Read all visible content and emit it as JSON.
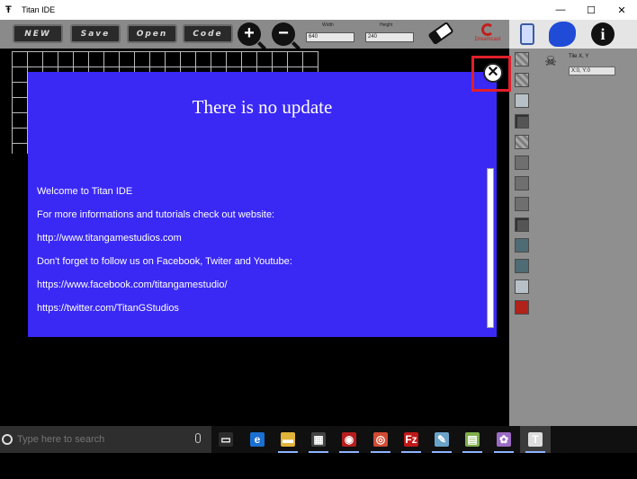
{
  "window": {
    "title": "Titan IDE",
    "controls": {
      "minimize": "—",
      "maximize": "☐",
      "close": "✕"
    }
  },
  "toolbar": {
    "new_label": "NEW",
    "save_label": "Save",
    "open_label": "Open",
    "code_label": "Code",
    "zoom_in": "+",
    "zoom_out": "−",
    "width_label": "Width",
    "width_value": "640",
    "height_label": "Height",
    "height_value": "240",
    "eraser_icon": "eraser-icon",
    "dreamcast_text": "Dreamcast"
  },
  "right_header": {
    "handheld_icon": "handheld-icon",
    "sonic_icon": "sonic-icon",
    "info_label": "i"
  },
  "right_panel": {
    "tile_label": "Tile X, Y",
    "tile_coord": "X:0, Y:0",
    "ghost_icon": "☠"
  },
  "dialog": {
    "title": "There is no update",
    "lines": [
      "Welcome to Titan IDE",
      "For more informations and tutorials check out website:",
      "http://www.titangamestudios.com",
      "Don't forget to follow us on Facebook, Twiter and Youtube:",
      "https://www.facebook.com/titangamestudio/",
      "https://twitter.com/TitanGStudios"
    ],
    "close_glyph": "✕"
  },
  "taskbar": {
    "search_placeholder": "Type here to search",
    "apps": [
      {
        "name": "task-view",
        "glyph": "▭",
        "color": "#2b2b2b"
      },
      {
        "name": "edge",
        "glyph": "e",
        "color": "#1b6fd1"
      },
      {
        "name": "file-explorer",
        "glyph": "▬",
        "color": "#e0b43a"
      },
      {
        "name": "store",
        "glyph": "▦",
        "color": "#444"
      },
      {
        "name": "red-app",
        "glyph": "◉",
        "color": "#b81d1d"
      },
      {
        "name": "chrome",
        "glyph": "◎",
        "color": "#d14b33"
      },
      {
        "name": "filezilla",
        "glyph": "Fz",
        "color": "#c01818"
      },
      {
        "name": "notebook-app",
        "glyph": "✎",
        "color": "#6aa3c8"
      },
      {
        "name": "notepad-app",
        "glyph": "▤",
        "color": "#7eae4b"
      },
      {
        "name": "paint-app",
        "glyph": "✿",
        "color": "#9b6bc3"
      },
      {
        "name": "titan-ide",
        "glyph": "T",
        "color": "#ddd"
      }
    ]
  },
  "colors": {
    "dialog_bg": "#3a28f5",
    "highlight": "#e0202a",
    "toolbar_bg": "#8a8a8a"
  }
}
